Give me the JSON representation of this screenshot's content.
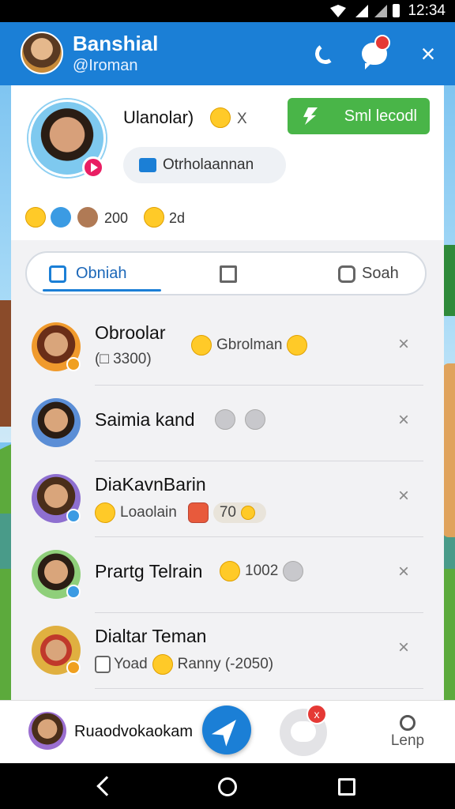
{
  "status_bar": {
    "time": "12:34"
  },
  "header": {
    "title": "Banshial",
    "handle": "@Iroman",
    "close_glyph": "×",
    "icons": [
      "phone-icon",
      "chat-icon",
      "close-icon"
    ]
  },
  "profile": {
    "name": "Ulanolar)",
    "name_suffix": "X",
    "cta_label": "Sml lecodl",
    "bubble_text": "Otrholaannan",
    "stats": {
      "count1": "200",
      "count2": "2d"
    }
  },
  "tabs": [
    {
      "label": "Obniah",
      "active": true
    },
    {
      "label": "",
      "active": false
    },
    {
      "label": "Soah",
      "active": false
    }
  ],
  "contacts": [
    {
      "name": "Obroolar",
      "sub1": "(□ 3300)",
      "sub2": "Gbrolman"
    },
    {
      "name": "Saimia kand",
      "sub1": "",
      "sub2": ""
    },
    {
      "name": "DiaKavnBarin",
      "sub1": "Loaolain",
      "sub2": "70"
    },
    {
      "name": "Prartg Telrain",
      "sub1": "1002",
      "sub2": ""
    },
    {
      "name": "Dialtar Teman",
      "sub1": "Yoad",
      "sub2": "Ranny (-2050)"
    }
  ],
  "row_close_glyph": "×",
  "bottom_bar": {
    "label": "Ruaodvokaokam",
    "chat_badge": "x",
    "more_label": "Lenp"
  },
  "colors": {
    "accent": "#1b7fd6",
    "cta": "#49b548",
    "badge": "#e53935"
  }
}
